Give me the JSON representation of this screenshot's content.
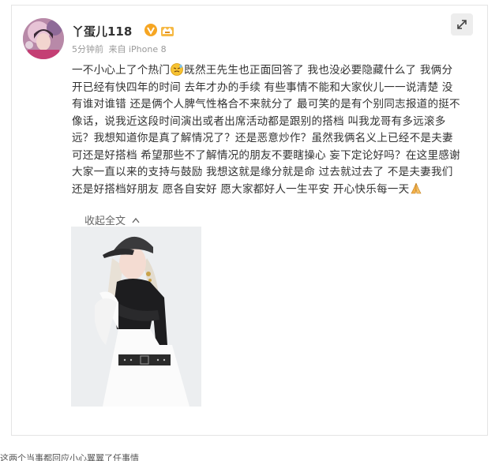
{
  "post": {
    "username": "丫蛋儿118",
    "time": "5分钟前",
    "source": "来自 iPhone 8",
    "text_lines": [
      [
        "一不小心上了个热门",
        "既然王先生也正面回答了 我也没必要隐藏什么了  我俩分"
      ],
      [
        "开已经有快四年的时间 去年才办的手续 有些事情不能和大家伙儿一一说清楚 没"
      ],
      [
        "有谁对谁错 还是俩个人脾气性格合不来就分了 最可笑的是有个别同志报道的挺不"
      ],
      [
        "像话，说我近这段时间演出或者出席活动都是跟别的搭档 叫我龙哥有多远滚多"
      ],
      [
        "远？我想知道你是真了解情况了？还是恶意炒作？虽然我俩名义上已经不是夫妻"
      ],
      [
        "可还是好搭档 希望那些不了解情况的朋友不要瞎操心 妄下定论好吗？在这里感谢"
      ],
      [
        "大家一直以来的支持与鼓励 我想这就是缘分就是命 过去就过去了 不是夫妻我们"
      ],
      [
        "还是好搭档好朋友 愿各自安好 愿大家都好人一生平安 开心快乐每一天"
      ]
    ],
    "collapse_label": "收起全文"
  },
  "icons": {
    "verified": "verified-v-icon",
    "level": "crown-level-icon",
    "expand": "expand-arrows-icon",
    "emoji_sweat": "sweat-smile-emoji",
    "emoji_pray": "praying-hands-emoji",
    "collapse": "chevron-up-icon"
  },
  "colors": {
    "verified_orange": "#f6a623",
    "link_gray": "#666666",
    "meta_gray": "#999999",
    "text": "#333333"
  },
  "footer": {
    "caption": "这两个当事都回应小心翼翼了任事情"
  }
}
